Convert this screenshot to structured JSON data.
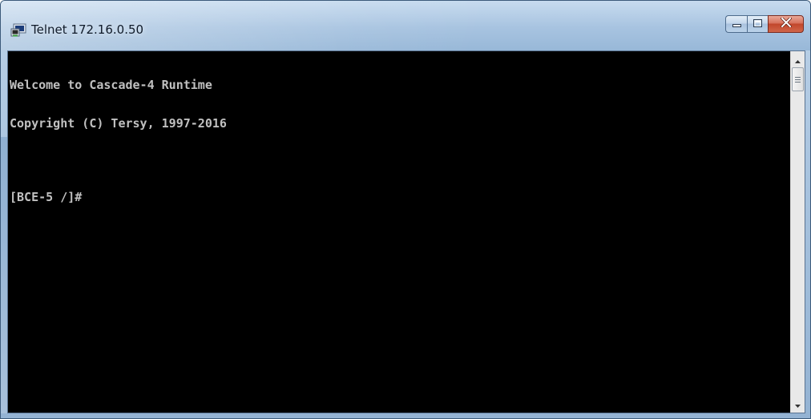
{
  "window": {
    "title": "Telnet 172.16.0.50",
    "icon": "telnet-console-icon"
  },
  "caption_buttons": {
    "minimize_icon": "minimize-icon",
    "maximize_icon": "maximize-icon",
    "close_icon": "close-icon"
  },
  "console": {
    "lines": [
      "Welcome to Cascade-4 Runtime",
      "Copyright (C) Tersy, 1997-2016",
      "",
      "[BCE-5 /]#"
    ],
    "background": "#000000",
    "foreground": "#c0c0c0"
  },
  "scrollbar": {
    "up_icon": "scroll-up-arrow-icon",
    "down_icon": "scroll-down-arrow-icon",
    "thumb_icon": "scroll-thumb-grip-icon"
  },
  "colors": {
    "titlebar": "#a7c3e0",
    "close_button": "#c1462b"
  }
}
